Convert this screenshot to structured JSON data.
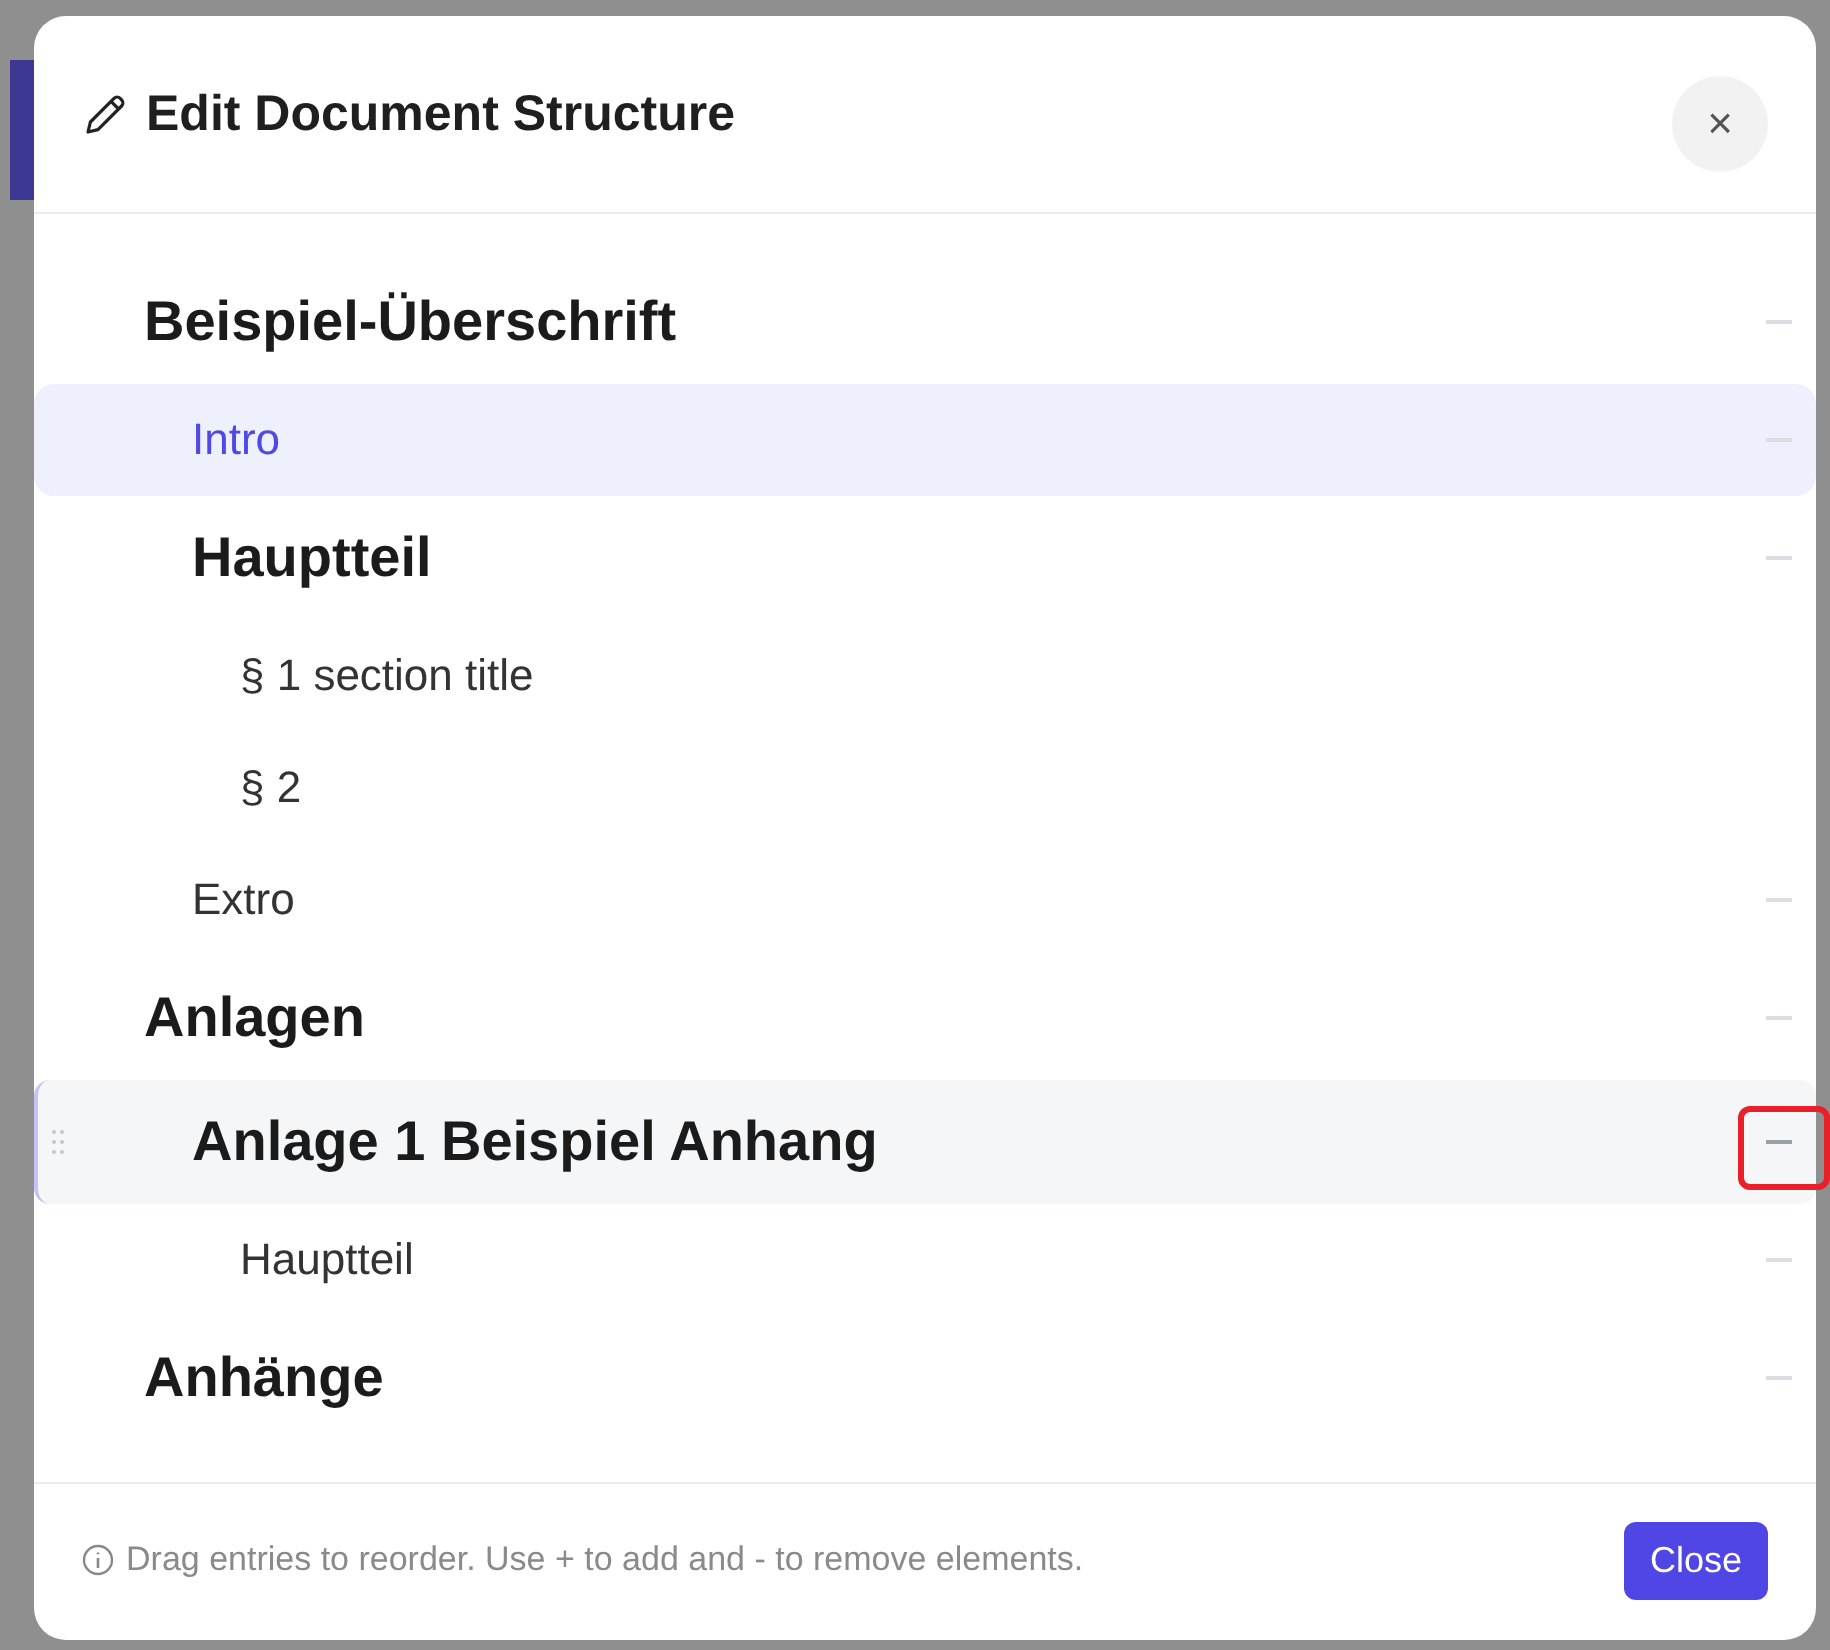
{
  "dialog": {
    "title": "Edit Document Structure",
    "close_icon": "×"
  },
  "outline": [
    {
      "label": "Beispiel-Überschrift",
      "kind": "heading",
      "selected": false,
      "hovered": false,
      "removable": true,
      "highlighted": false,
      "children": [
        {
          "label": "Intro",
          "kind": "entry",
          "selected": true,
          "hovered": false,
          "removable": true,
          "highlighted": false
        },
        {
          "label": "Hauptteil",
          "kind": "heading",
          "selected": false,
          "hovered": false,
          "removable": true,
          "highlighted": false,
          "children": [
            {
              "label": "§ 1 section title",
              "kind": "entry",
              "selected": false,
              "hovered": false,
              "removable": false,
              "highlighted": false
            },
            {
              "label": "§ 2",
              "kind": "entry",
              "selected": false,
              "hovered": false,
              "removable": false,
              "highlighted": false
            }
          ]
        },
        {
          "label": "Extro",
          "kind": "entry",
          "selected": false,
          "hovered": false,
          "removable": true,
          "highlighted": false
        }
      ]
    },
    {
      "label": "Anlagen",
      "kind": "heading",
      "selected": false,
      "hovered": false,
      "removable": true,
      "highlighted": false,
      "children": [
        {
          "label": "Anlage 1 Beispiel Anhang",
          "kind": "heading",
          "selected": false,
          "hovered": true,
          "removable": true,
          "highlighted": true,
          "children": [
            {
              "label": "Hauptteil",
              "kind": "entry",
              "selected": false,
              "hovered": false,
              "removable": true,
              "highlighted": false
            }
          ]
        }
      ]
    },
    {
      "label": "Anhänge",
      "kind": "heading",
      "selected": false,
      "hovered": false,
      "removable": true,
      "highlighted": false
    }
  ],
  "footer": {
    "hint": "Drag entries to reorder. Use + to add and - to remove elements.",
    "button": "Close"
  }
}
